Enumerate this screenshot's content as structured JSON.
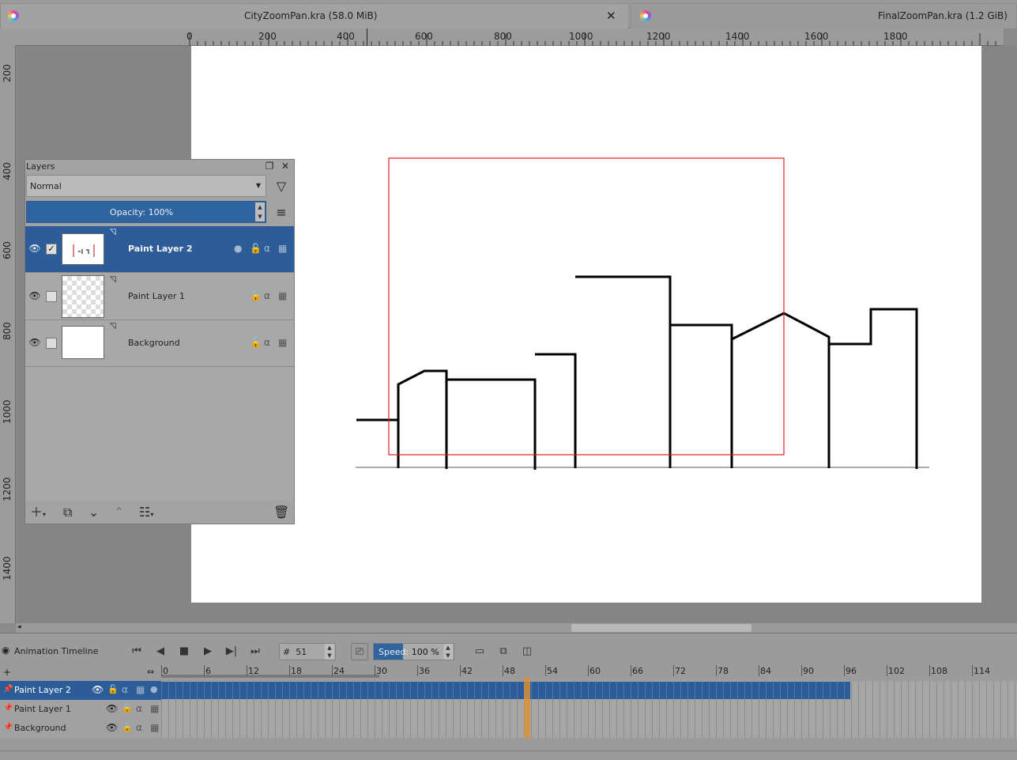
{
  "tabs": [
    {
      "title": "CityZoomPan.kra (58.0 MiB)",
      "closable": true
    },
    {
      "title": "FinalZoomPan.kra (1.2 GiB)",
      "closable": false
    }
  ],
  "ruler_h": [
    "0",
    "200",
    "400",
    "600",
    "800",
    "1000",
    "1200",
    "1400",
    "1600",
    "1800"
  ],
  "ruler_v": [
    "200",
    "400",
    "600",
    "800",
    "1000",
    "1200",
    "1400"
  ],
  "layers_docker": {
    "title": "Layers",
    "blend_mode": "Normal",
    "opacity_label": "Opacity: 100%",
    "layers": [
      {
        "name": "Paint Layer 2",
        "active": true,
        "checked": true
      },
      {
        "name": "Paint Layer 1",
        "active": false,
        "checked": false
      },
      {
        "name": "Background",
        "active": false,
        "checked": false,
        "locked": true
      }
    ]
  },
  "timeline": {
    "title": "Animation Timeline",
    "frame_prefix": "#",
    "current_frame": "51",
    "speed_label": "Speed:",
    "speed_value": "100 %",
    "speed_fraction": 0.37,
    "ruler_ticks": [
      "0",
      "6",
      "12",
      "18",
      "24",
      "30",
      "36",
      "42",
      "48",
      "54",
      "60",
      "66",
      "72",
      "78",
      "84",
      "90",
      "96",
      "102",
      "108",
      "114"
    ],
    "rows": [
      {
        "name": "Paint Layer 2",
        "active": true
      },
      {
        "name": "Paint Layer 1",
        "active": false
      },
      {
        "name": "Background",
        "active": false
      }
    ]
  },
  "colors": {
    "selection_blue": "#2c5d99",
    "frame_border_red": "#e02020",
    "playhead_orange": "#d8913a"
  },
  "icons": [
    "krita-app-icon",
    "close-icon",
    "eye-icon",
    "filter-icon",
    "hamburger-menu-icon",
    "add-layer-icon",
    "duplicate-icon",
    "move-down-icon",
    "move-up-icon",
    "properties-icon",
    "trash-icon",
    "lock-icon",
    "alpha-icon",
    "play-icon",
    "stop-icon"
  ]
}
